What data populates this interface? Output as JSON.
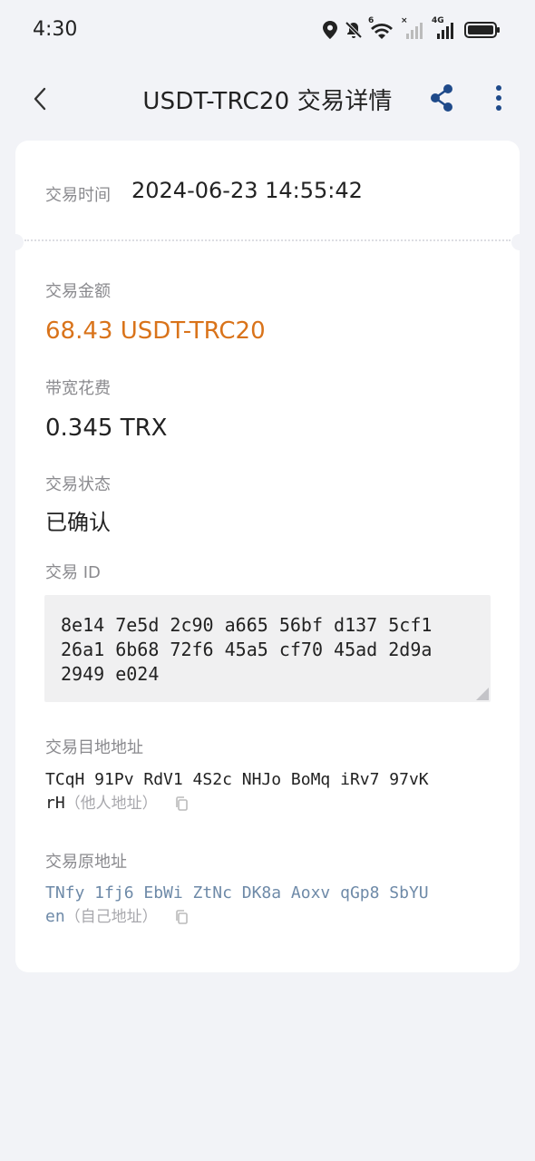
{
  "status_bar": {
    "time": "4:30",
    "wifi_tag": "6",
    "cell1_tag": "×",
    "cell2_tag": "4G"
  },
  "app_bar": {
    "title": "USDT-TRC20 交易详情"
  },
  "details": {
    "time_label": "交易时间",
    "time_value": "2024-06-23 14:55:42",
    "amount_label": "交易金额",
    "amount_value": "68.43 USDT-TRC20",
    "fee_label": "带宽花费",
    "fee_value": "0.345 TRX",
    "status_label": "交易状态",
    "status_value": "已确认",
    "id_label": "交易 ID",
    "id_value": "8e14 7e5d 2c90 a665 56bf d137 5cf1\n26a1 6b68 72f6 45a5 cf70 45ad 2d9a\n2949 e024",
    "dest_label": "交易目地地址",
    "dest_line1": "TCqH 91Pv RdV1 4S2c NHJo BoMq iRv7 97vK",
    "dest_line2": "rH",
    "dest_note": "（他人地址）",
    "src_label": "交易原地址",
    "src_line1": "TNfy 1fj6 EbWi ZtNc DK8a Aoxv qGp8 SbYU",
    "src_line2": "en",
    "src_note": "（自己地址）"
  },
  "colors": {
    "amount": "#d9731a",
    "source_address": "#6e8aa8",
    "share_icon": "#1f4a8a"
  }
}
